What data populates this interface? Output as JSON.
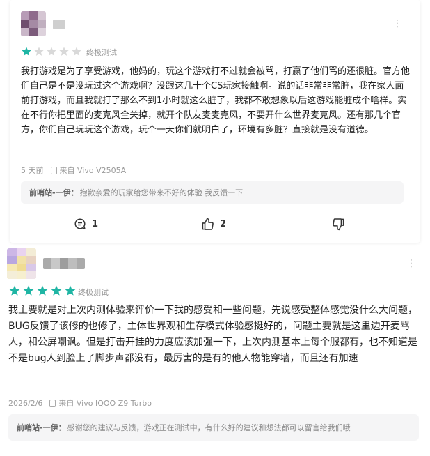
{
  "reviews": [
    {
      "rating": 1,
      "tag": "终极测试",
      "text": "我打游戏是为了享受游戏，他妈的，玩这个游戏打不过就会被骂，打赢了他们骂的还很脏。官方他们自己是不是没玩过这个游戏啊？没跟这几十个CS玩家接触啊。说的话非常非常脏，我在家人面前打游戏，而且我就打了那么不到1小时就这么脏了，我都不敢想象以后这游戏能脏成个啥样。实在不行你把里面的麦克风全关掉，就开个队友麦麦克风，不要开什么世界麦克风。还有那几个官方，你们自己玩玩这个游戏，玩个一天你们就明白了，环境有多脏？直接就是没有道德。",
      "time": "5 天前",
      "device": "来自 Vivo V2505A",
      "reply_author": "前哨站-一伊：",
      "reply_text": "抱歉亲爱的玩家给您带来不好的体验 我反馈一下",
      "comments": "1",
      "likes": "2"
    },
    {
      "rating": 5,
      "tag": "终极测试",
      "text": "我主要就是对上次内测体验来评价一下我的感受和一些问题，先说感受整体感觉没什么大问题，BUG反馈了该修的也修了，主体世界观和生存模式体验感挺好的，问题主要就是这里边开麦骂人，和公屏嘲讽。但是打击开挂的力度应该加强一下，上次内测基本上每个服都有，也不知道是不是bug人到脸上了脚步声都没有，最厉害的是有的他人物能穿墙，而且还有加速",
      "time": "2026/2/6",
      "device": "来自 Vivo IQOO Z9 Turbo",
      "reply_author": "前哨站-一伊：",
      "reply_text": "感谢您的建议与反馈，游戏正在测试中，有什么好的建议和想法都可以留言给我们哦"
    }
  ],
  "colors": {
    "star_on": "#1fb5a4",
    "star_off": "#d9d9d9"
  },
  "icons": {
    "comment": "comment-icon",
    "like": "thumbs-up-icon",
    "dislike": "thumbs-down-icon",
    "device": "phone-icon",
    "more": "more-vertical-icon"
  }
}
